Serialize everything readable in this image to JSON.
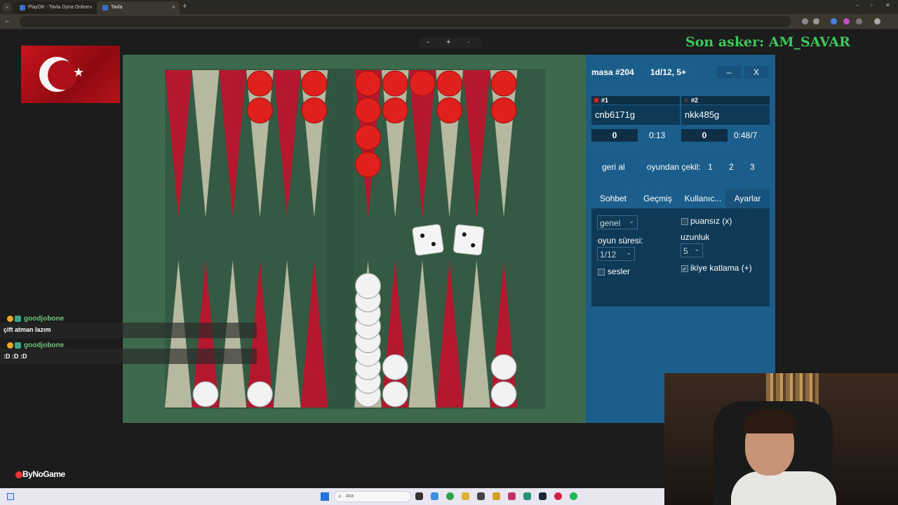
{
  "browser": {
    "tabs": [
      {
        "title": "PlayOK - Tavla Oyna Online",
        "active": false
      },
      {
        "title": "Tavla",
        "active": true
      }
    ],
    "new_tab_symbol": "+",
    "window_controls": [
      "–",
      "▫",
      "✕"
    ]
  },
  "zoom_controls": {
    "minus": "-",
    "plus": "+",
    "dot": "·"
  },
  "overlay": {
    "son_asker": "Son asker: AM_SAVAR",
    "brand": "ByNoGame"
  },
  "chat": [
    {
      "user": "goodjobone",
      "message": "çift atman lazım"
    },
    {
      "user": "goodjobone",
      "message": ":D :D :D"
    }
  ],
  "game": {
    "table_title": "masa #204",
    "table_info": "1d/12, 5+",
    "minimize_label": "–",
    "close_label": "X",
    "players": [
      {
        "seat": "#1",
        "name": "cnb6171g",
        "score": "0",
        "time": "0:13",
        "color": "red"
      },
      {
        "seat": "#2",
        "name": "nkk485g",
        "score": "0",
        "time": "0:48/7",
        "color": "white"
      }
    ],
    "actions": {
      "undo": "geri al",
      "resign": "oyundan çekil:",
      "resign_options": [
        "1",
        "2",
        "3"
      ]
    },
    "panel_tabs": [
      "Sohbet",
      "Geçmiş",
      "Kullanıc...",
      "Ayarlar"
    ],
    "active_tab": "Ayarlar",
    "settings": {
      "room_select": "genel",
      "game_time_label": "oyun süresi:",
      "game_time_value": "1/12",
      "sounds_label": "sesler",
      "sounds_checked": false,
      "pointless_label": "puansız (x)",
      "pointless_checked": false,
      "length_label": "uzunluk",
      "length_value": "5",
      "doubling_label": "ikiye katlama (+)",
      "doubling_checked": true
    },
    "dice": [
      2,
      2
    ],
    "board": {
      "colors": {
        "dark_point": "#b3182e",
        "light_point": "#b6b9a0",
        "red_checker": "#e0201c",
        "white_checker": "#f2f2f2"
      },
      "top_points": [
        {
          "index": 0,
          "red": 0
        },
        {
          "index": 1,
          "red": 0
        },
        {
          "index": 2,
          "red": 0
        },
        {
          "index": 3,
          "red": 2
        },
        {
          "index": 4,
          "red": 0
        },
        {
          "index": 5,
          "red": 2
        },
        {
          "index": 6,
          "red": 4
        },
        {
          "index": 7,
          "red": 2
        },
        {
          "index": 8,
          "red": 1
        },
        {
          "index": 9,
          "red": 2
        },
        {
          "index": 10,
          "red": 0
        },
        {
          "index": 11,
          "red": 2
        }
      ],
      "bottom_points": [
        {
          "index": 0,
          "white": 0
        },
        {
          "index": 1,
          "white": 1
        },
        {
          "index": 2,
          "white": 0
        },
        {
          "index": 3,
          "white": 1
        },
        {
          "index": 4,
          "white": 0
        },
        {
          "index": 5,
          "white": 0
        },
        {
          "index": 6,
          "white": 9
        },
        {
          "index": 7,
          "white": 2
        },
        {
          "index": 8,
          "white": 0
        },
        {
          "index": 9,
          "white": 0
        },
        {
          "index": 10,
          "white": 0
        },
        {
          "index": 11,
          "white": 2
        }
      ]
    }
  },
  "taskbar": {
    "search_placeholder": "Ara"
  }
}
